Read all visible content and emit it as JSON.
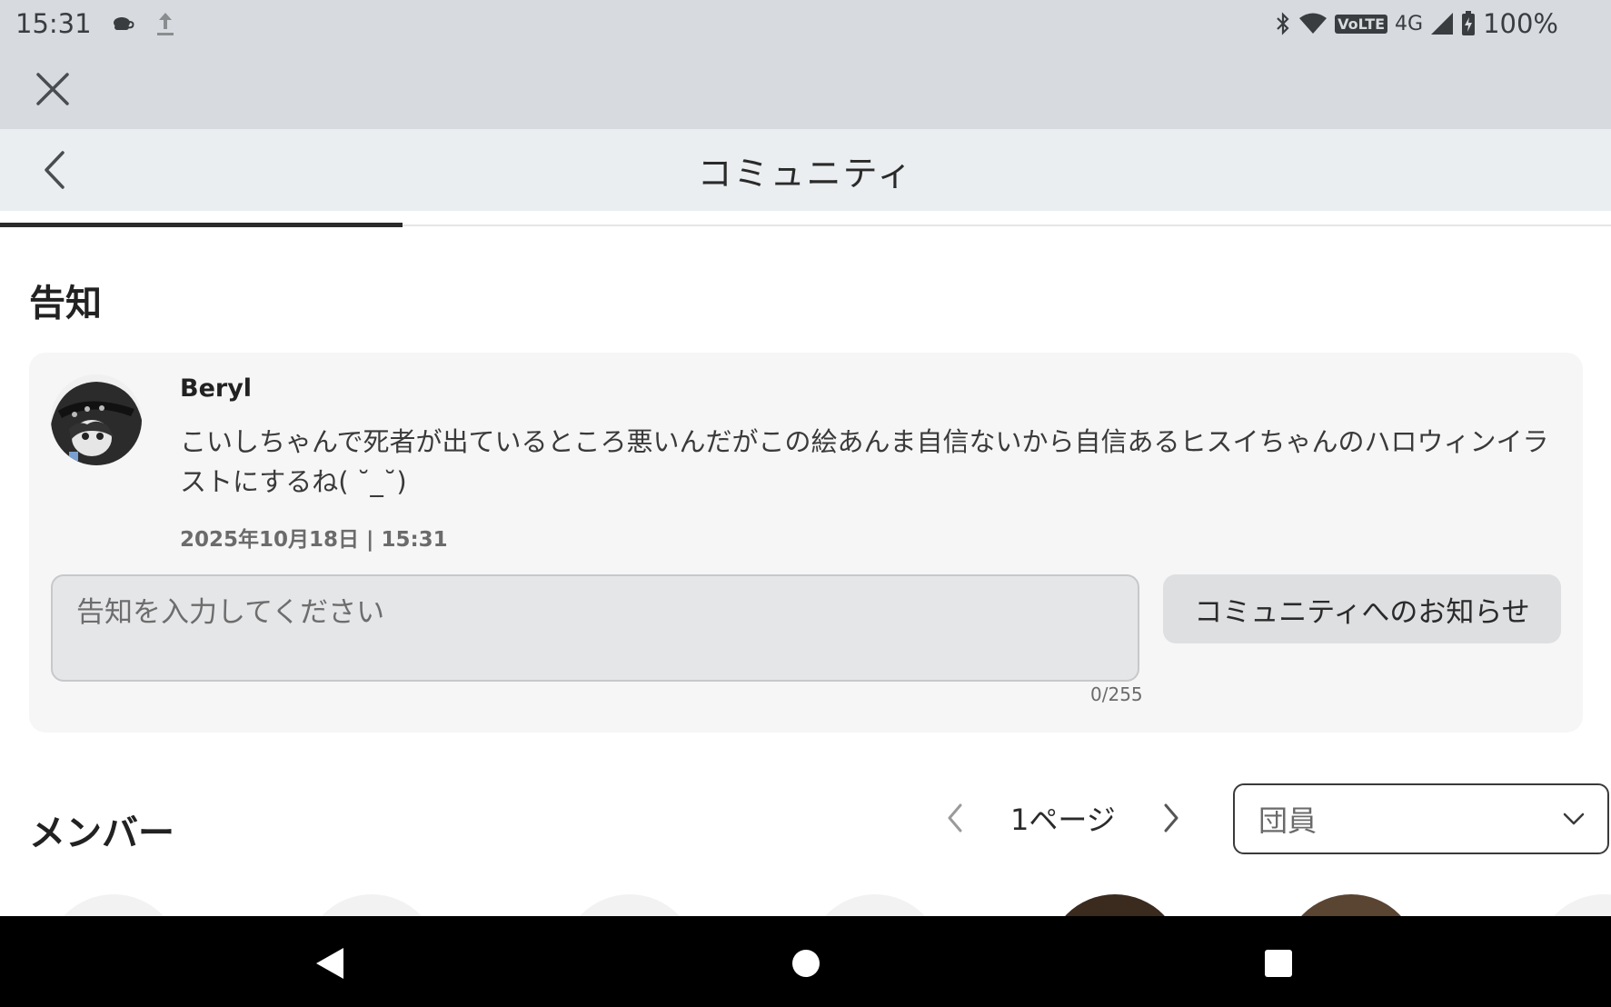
{
  "status_bar": {
    "time": "15:31",
    "icons": [
      "coffee-icon",
      "upload-icon",
      "bluetooth-icon",
      "wifi-icon",
      "volte-badge",
      "signal-icon",
      "battery-icon"
    ],
    "volte": "VoLTE",
    "network": "4G",
    "battery": "100%"
  },
  "header": {
    "title": "コミュニティ"
  },
  "announcement": {
    "section_title": "告知",
    "author": "Beryl",
    "message": "こいしちゃんで死者が出ているところ悪いんだがこの絵あんま自信ないから自信あるヒスイちゃんのハロウィンイラストにするね( ˘_˘)",
    "timestamp": "2025年10月18日 | 15:31",
    "input_placeholder": "告知を入力してください",
    "input_value": "",
    "char_count": "0/255",
    "notify_button": "コミュニティへのお知らせ"
  },
  "members": {
    "section_title": "メンバー",
    "page_label": "1ページ",
    "role_selected": "団員"
  },
  "colors": {
    "status_bg": "#d7dbdf",
    "header_bg": "#ebeef0",
    "card_bg": "#f6f6f6",
    "nav_bg": "#000000"
  }
}
